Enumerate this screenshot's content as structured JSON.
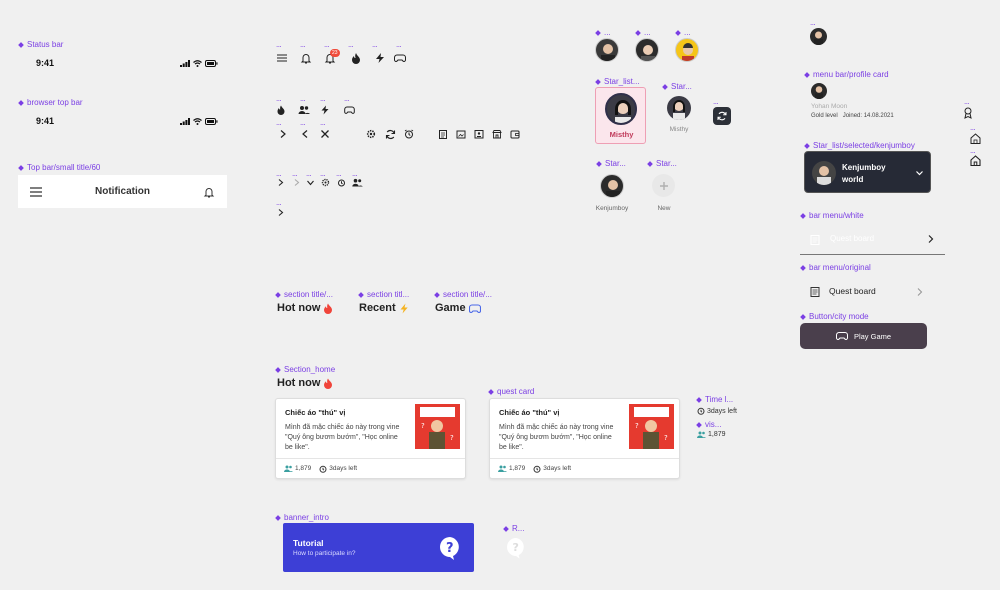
{
  "labels": {
    "status_bar": "Status bar",
    "browser_top_bar": "browser top bar",
    "top_bar_small": "Top bar/small title/60",
    "section_title_1": "section title/...",
    "section_title_2": "section titl...",
    "section_title_3": "section title/...",
    "section_home": "Section_home",
    "quest_card": "quest card",
    "time_l": "Time l...",
    "vis": "vis...",
    "banner_intro": "banner_intro",
    "r": "R...",
    "star_list_1": "Star_list...",
    "star_2": "Star...",
    "star_3": "Star...",
    "star_4": "Star...",
    "menu_bar_profile": "menu bar/profile card",
    "star_selected": "Star_list/selected/kenjumboy",
    "bar_menu_white": "bar menu/white",
    "bar_menu_original": "bar menu/original",
    "button_city": "Button/city mode",
    "dots": "..."
  },
  "status_bar": {
    "time": "9:41"
  },
  "browser_bar": {
    "time": "9:41"
  },
  "top_bar": {
    "title": "Notification"
  },
  "notification_badge": "23",
  "sections": {
    "hot": "Hot now",
    "recent": "Recent",
    "game": "Game",
    "home_title": "Hot now"
  },
  "quest_cards": [
    {
      "title": "Chiếc áo \"thú\" vị",
      "desc": "Mình đã mặc chiếc áo này trong vine \"Quý ông bươm bướm\", \"Học online be like\".",
      "members": "1,879",
      "time": "3days left"
    },
    {
      "title": "Chiếc áo \"thú\" vị",
      "desc": "Mình đã mặc chiếc áo này trong vine \"Quý ông bươm bướm\", \"Học online be like\".",
      "members": "1,879",
      "time": "3days left"
    }
  ],
  "time_left": "3days left",
  "visitors": "1,879",
  "banner": {
    "title": "Tutorial",
    "subtitle": "How to participate in?"
  },
  "stars": {
    "misthy": "Misthy",
    "misthy_small": "Misthy",
    "kenjumboy": "Kenjumboy",
    "new": "New"
  },
  "profile": {
    "name": "Yohan Moon",
    "level": "Gold level",
    "joined": "Joined: 14.08.2021"
  },
  "selected_star": {
    "line1": "Kenjumboy",
    "line2": "world"
  },
  "bar_menu_white": {
    "label": "Quest board"
  },
  "bar_menu_original": {
    "label": "Quest board"
  },
  "play_button": {
    "label": "Play Game"
  },
  "colors": {
    "accent": "#7b3fe4",
    "banner": "#3d3fd6",
    "selected_bg": "#262a36",
    "button": "#4a3f4c",
    "badge": "#f04b3a",
    "misthy_border": "#ee9fb4"
  }
}
